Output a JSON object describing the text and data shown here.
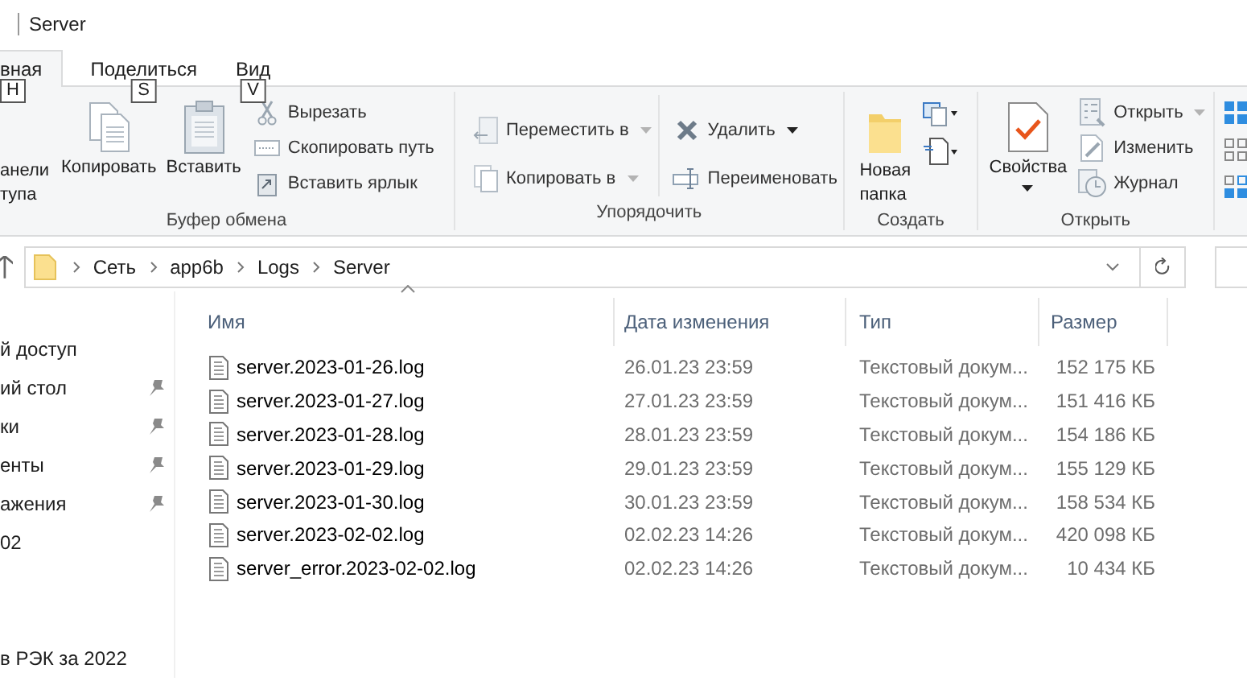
{
  "title_bar": {
    "title": "Server"
  },
  "tabs": [
    {
      "label": "вная",
      "key_tip": "H",
      "selected": true
    },
    {
      "label": "Поделиться",
      "key_tip": "S",
      "selected": false
    },
    {
      "label": "Вид",
      "key_tip": "V",
      "selected": false
    }
  ],
  "ribbon": {
    "groups": [
      {
        "label": "Буфер обмена",
        "columns": [
          {
            "kind": "large",
            "label": "анели\nтупа"
          },
          {
            "kind": "large",
            "label": "Копировать"
          },
          {
            "kind": "large",
            "label": "Вставить"
          },
          {
            "kind": "stack",
            "items": [
              {
                "label": "Вырезать",
                "dropdown": false
              },
              {
                "label": "Скопировать путь",
                "dropdown": false
              },
              {
                "label": "Вставить ярлык",
                "dropdown": false
              }
            ]
          }
        ]
      },
      {
        "label": "Упорядочить",
        "columns": [
          {
            "kind": "stack",
            "items": [
              {
                "label": "Переместить в",
                "dropdown": true
              },
              {
                "label": "Копировать в",
                "dropdown": true
              }
            ]
          },
          {
            "kind": "stack",
            "items": [
              {
                "label": "Удалить",
                "dropdown": true
              },
              {
                "label": "Переименовать",
                "dropdown": false
              }
            ]
          }
        ]
      },
      {
        "label": "Создать",
        "columns": [
          {
            "kind": "large",
            "label": "Новая\nпапка"
          },
          {
            "kind": "icons"
          }
        ]
      },
      {
        "label": "Открыть",
        "columns": [
          {
            "kind": "large",
            "label": "Свойства",
            "dropdown": true
          },
          {
            "kind": "stack",
            "items": [
              {
                "label": "Открыть",
                "dropdown": true
              },
              {
                "label": "Изменить",
                "dropdown": false
              },
              {
                "label": "Журнал",
                "dropdown": false
              }
            ]
          }
        ]
      },
      {
        "columns": [
          {
            "kind": "views"
          }
        ]
      }
    ]
  },
  "address": {
    "crumbs": [
      "Сеть",
      "app6b",
      "Logs",
      "Server"
    ]
  },
  "nav": {
    "sections": [
      {
        "items": [
          {
            "label": "й доступ",
            "pinned": false
          },
          {
            "label": "ий стол",
            "pinned": true
          },
          {
            "label": "ки",
            "pinned": true
          },
          {
            "label": "енты",
            "pinned": true
          },
          {
            "label": "ажения",
            "pinned": true
          },
          {
            "label": "02",
            "pinned": false
          }
        ]
      },
      {
        "items": [
          {
            "label": "в РЭК за 2022",
            "pinned": false
          }
        ]
      }
    ]
  },
  "table": {
    "columns": [
      "Имя",
      "Дата изменения",
      "Тип",
      "Размер"
    ],
    "rows": [
      {
        "name": "server.2023-01-26.log",
        "modified": "26.01.23 23:59",
        "type": "Текстовый докум...",
        "size": "152 175 КБ"
      },
      {
        "name": "server.2023-01-27.log",
        "modified": "27.01.23 23:59",
        "type": "Текстовый докум...",
        "size": "151 416 КБ"
      },
      {
        "name": "server.2023-01-28.log",
        "modified": "28.01.23 23:59",
        "type": "Текстовый докум...",
        "size": "154 186 КБ"
      },
      {
        "name": "server.2023-01-29.log",
        "modified": "29.01.23 23:59",
        "type": "Текстовый докум...",
        "size": "155 129 КБ"
      },
      {
        "name": "server.2023-01-30.log",
        "modified": "30.01.23 23:59",
        "type": "Текстовый докум...",
        "size": "158 534 КБ"
      },
      {
        "name": "server.2023-02-02.log",
        "modified": "02.02.23 14:26",
        "type": "Текстовый докум...",
        "size": "420 098 КБ"
      },
      {
        "name": "server_error.2023-02-02.log",
        "modified": "02.02.23 14:26",
        "type": "Текстовый докум...",
        "size": "10 434 КБ"
      }
    ]
  }
}
